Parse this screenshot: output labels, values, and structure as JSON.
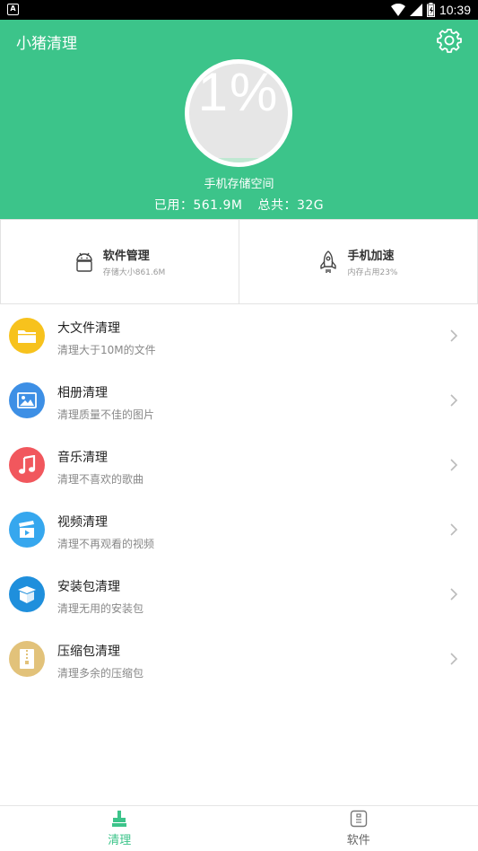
{
  "status_bar": {
    "time": "10:39"
  },
  "header": {
    "title": "小猪清理",
    "gauge_percent": "1%",
    "gauge_level": 0.01,
    "storage_label": "手机存储空间",
    "used_text": "已用：561.9M",
    "total_text": "总共：32G"
  },
  "cards": [
    {
      "title": "软件管理",
      "subtitle": "存储大小861.6M",
      "icon": "android-icon"
    },
    {
      "title": "手机加速",
      "subtitle": "内存占用23%",
      "icon": "rocket-icon"
    }
  ],
  "list": [
    {
      "title": "大文件清理",
      "subtitle": "清理大于10M的文件",
      "icon": "folder-icon",
      "color": "#f7c21d"
    },
    {
      "title": "相册清理",
      "subtitle": "清理质量不佳的图片",
      "icon": "image-icon",
      "color": "#3d8fe5"
    },
    {
      "title": "音乐清理",
      "subtitle": "清理不喜欢的歌曲",
      "icon": "music-note-icon",
      "color": "#f1575d"
    },
    {
      "title": "视频清理",
      "subtitle": "清理不再观看的视频",
      "icon": "video-icon",
      "color": "#36a7ee"
    },
    {
      "title": "安装包清理",
      "subtitle": "清理无用的安装包",
      "icon": "package-box-icon",
      "color": "#1f8fdc"
    },
    {
      "title": "压缩包清理",
      "subtitle": "清理多余的压缩包",
      "icon": "zip-icon",
      "color": "#e2c27a"
    }
  ],
  "bottom_nav": [
    {
      "label": "清理",
      "icon": "broom-icon",
      "active": true
    },
    {
      "label": "软件",
      "icon": "phone-app-icon",
      "active": false
    }
  ],
  "colors": {
    "brand": "#3cc48a",
    "active_tab": "#3cc48a"
  }
}
